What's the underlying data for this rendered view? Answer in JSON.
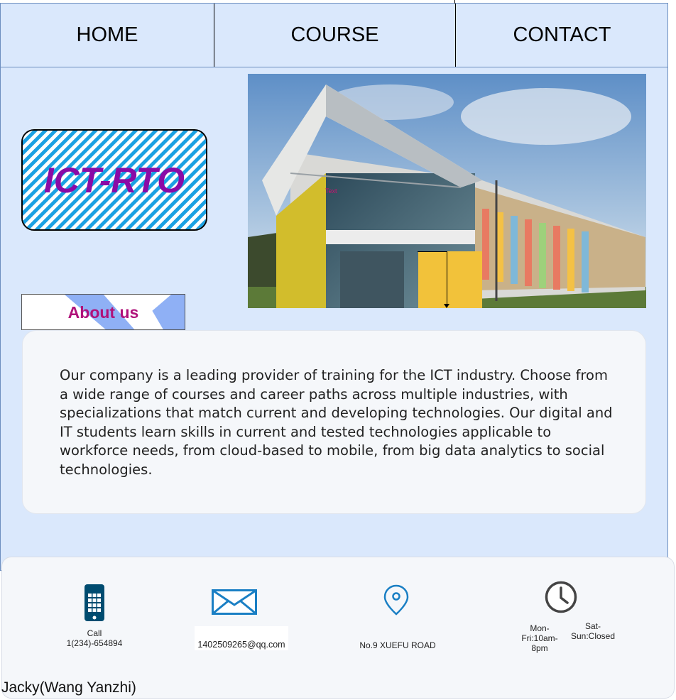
{
  "nav": {
    "items": [
      {
        "label": "HOME"
      },
      {
        "label": "COURSE"
      },
      {
        "label": "CONTACT"
      }
    ]
  },
  "logo": {
    "text": "ICT-RTO"
  },
  "hero": {
    "tag": "Text"
  },
  "about": {
    "tab_label": "About us",
    "text": "Our company is a leading provider of training for the ICT industry. Choose from a wide range of courses and career paths across multiple industries, with specializations that match current and developing technologies. Our digital and IT students learn skills in current and tested technologies applicable to workforce needs, from cloud-based to mobile, from big data analytics to social technologies."
  },
  "contact": {
    "call_label": "Call",
    "phone": "1(234)-654894",
    "email": "1402509265@qq.com",
    "address": "No.9 XUEFU ROAD",
    "hours_weekday": "Mon-Fri:10am-8pm",
    "hours_weekend": "Sat-Sun:Closed"
  },
  "author": "Jacky(Wang Yanzhi)",
  "colors": {
    "background": "#dae8fc",
    "logo_text": "#8a0aa6",
    "logo_stripes": "#1ba1e2",
    "about_label": "#b0127a",
    "icon_blue": "#1a7fc4",
    "icon_dark": "#004c70"
  },
  "icons": [
    "phone-icon",
    "envelope-icon",
    "location-pin-icon",
    "clock-icon"
  ]
}
